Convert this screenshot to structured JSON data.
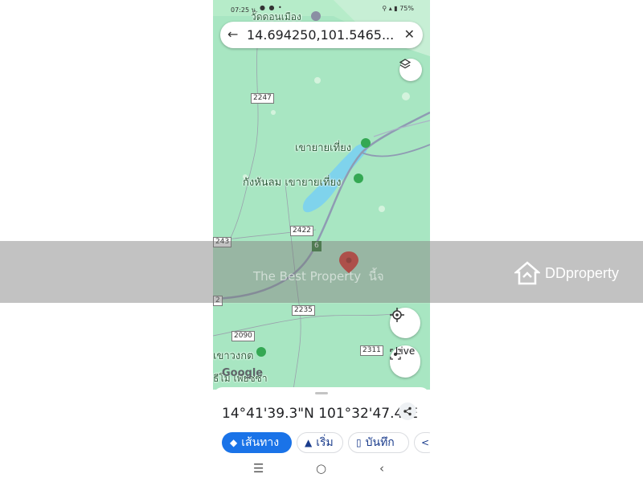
{
  "status_bar": {
    "time": "07:25 น.",
    "battery": "75%"
  },
  "search": {
    "query": "14.694250,101.5465..."
  },
  "map": {
    "labels": {
      "top_place": "วัดดอนเมือง",
      "reservoir": "เขายายเที่ยง",
      "windfarm": "กังหันลม เขายายเที่ยง",
      "bottom_left": "เขาวงกต",
      "bottom_place": "ธีโม เพียซซ่า"
    },
    "road_numbers": [
      "2247",
      "2422",
      "243",
      "2235",
      "2090",
      "2311",
      "2",
      "6"
    ],
    "google_logo": "Google",
    "live_label": "Live"
  },
  "place_sheet": {
    "coordinates": "14°41'39.3\"N 101°32'47.4\"E",
    "actions": {
      "directions": "เส้นทาง",
      "start": "เริ่ม",
      "save": "บันทึก"
    }
  },
  "watermark": {
    "overlay_text": "The Best Property",
    "overlay_text_2": "นี้จ",
    "brand": "DDproperty"
  },
  "colors": {
    "map_green": "#a8e6c2",
    "water": "#7fd3ec",
    "pin_red": "#d93025",
    "accent_blue": "#1a73e8"
  }
}
